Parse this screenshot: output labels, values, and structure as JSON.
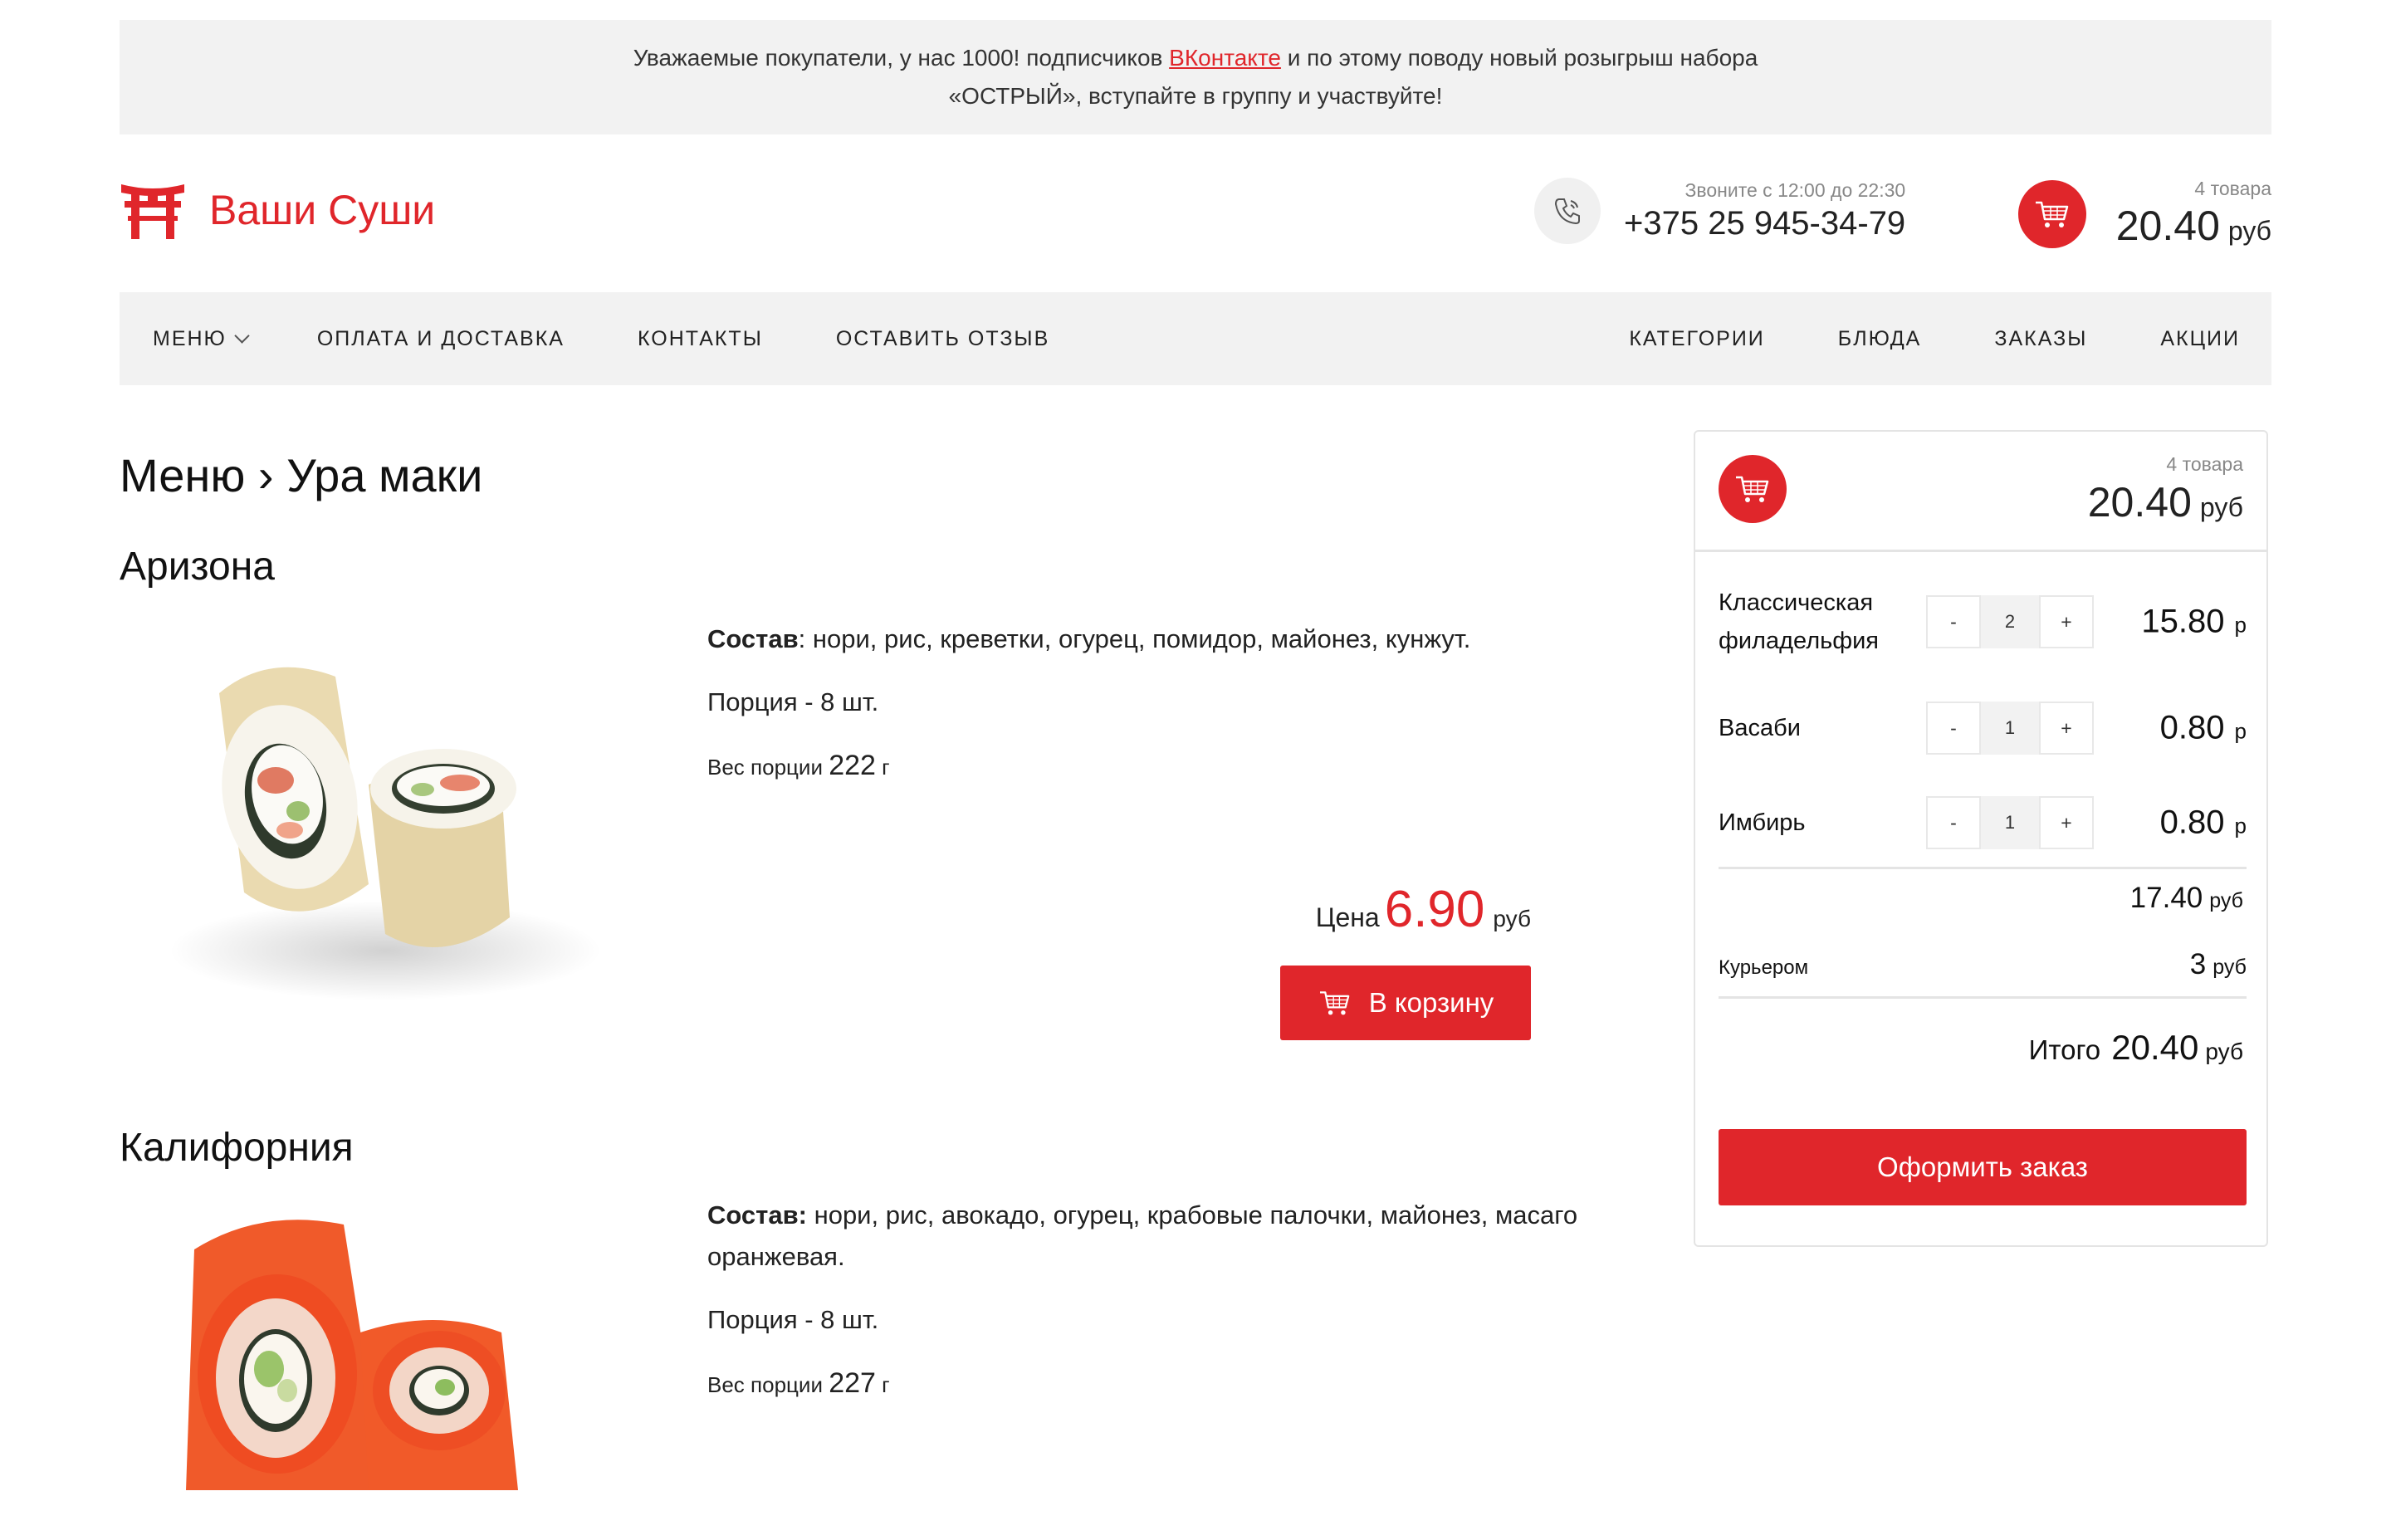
{
  "announcement": {
    "text_before": "Уважаемые покупатели, у нас 1000! подписчиков ",
    "link": "ВКонтакте",
    "text_after": " и по этому поводу новый розыгрыш набора",
    "line2": "«ОСТРЫЙ», вступайте в группу и участвуйте!"
  },
  "header": {
    "brand": "Ваши Суши",
    "phone_hint": "Звоните с 12:00 до 22:30",
    "phone": "+375 25 945-34-79",
    "cart_count": "4 товара",
    "cart_sum": "20.40",
    "cart_currency": "руб"
  },
  "nav": {
    "left": [
      "Меню",
      "Оплата и доставка",
      "Контакты",
      "Оставить отзыв"
    ],
    "right": [
      "Категории",
      "Блюда",
      "Заказы",
      "Акции"
    ]
  },
  "breadcrumb": "Меню › Ура маки",
  "products": [
    {
      "title": "Аризона",
      "composition_label": "Состав",
      "composition": ": нори, рис, креветки, огурец, помидор, майонез, кунжут.",
      "portion": "Порция - 8 шт.",
      "weight_label": "Вес порции",
      "weight": "222",
      "weight_unit": "г",
      "price_label": "Цена",
      "price": "6.90",
      "price_currency": "руб",
      "button": "В корзину"
    },
    {
      "title": "Калифорния",
      "composition_label": "Состав:",
      "composition": " нори, рис, авокадо, огурец, крабовые палочки, майонез, масаго оранжевая.",
      "portion": "Порция - 8 шт.",
      "weight_label": "Вес порции",
      "weight": "227",
      "weight_unit": "г"
    }
  ],
  "sidecart": {
    "count": "4 товара",
    "sum": "20.40",
    "currency": "руб",
    "items": [
      {
        "name": "Классическая филадельфия",
        "qty": "2",
        "amount": "15.80",
        "currency": "р"
      },
      {
        "name": "Васаби",
        "qty": "1",
        "amount": "0.80",
        "currency": "р"
      },
      {
        "name": "Имбирь",
        "qty": "1",
        "amount": "0.80",
        "currency": "р"
      }
    ],
    "minus": "-",
    "plus": "+",
    "subtotal": "17.40",
    "subtotal_currency": "руб",
    "delivery_label": "Курьером",
    "delivery_value": "3",
    "delivery_currency": "руб",
    "total_label": "Итого",
    "total": "20.40",
    "total_currency": "руб",
    "order_button": "Оформить заказ"
  },
  "colors": {
    "accent": "#e0262b",
    "panel": "#f2f2f2"
  }
}
